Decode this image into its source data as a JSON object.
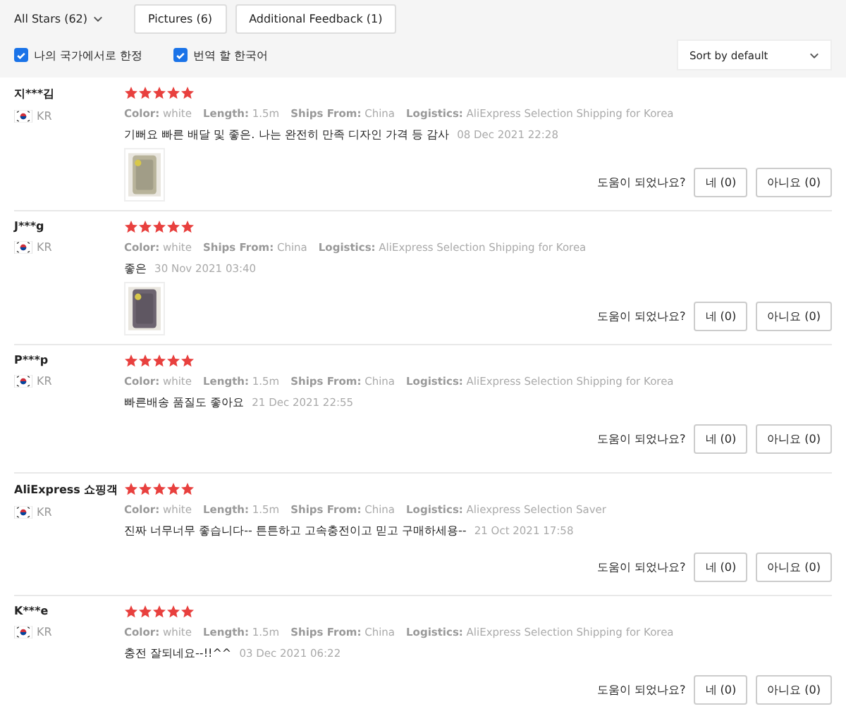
{
  "filters": {
    "star_filter": "All Stars (62)",
    "buttons": [
      "Pictures (6)",
      "Additional Feedback (1)"
    ]
  },
  "options": [
    {
      "label": "나의 국가에서로 한정",
      "checked": true
    },
    {
      "label": "번역 할 한국어",
      "checked": true
    }
  ],
  "sort": {
    "value": "Sort by default"
  },
  "reviews": [
    {
      "name": "지***김",
      "country": "KR",
      "stars": 5,
      "attributes": [
        {
          "label": "Color:",
          "value": "white"
        },
        {
          "label": "Length:",
          "value": "1.5m"
        },
        {
          "label": "Ships From:",
          "value": "China"
        },
        {
          "label": "Logistics:",
          "value": "AliExpress Selection Shipping for Korea"
        }
      ],
      "comment": "기뻐요 빠른 배달 및 좋은. 나는 완전히 만족 디자인 가격 등 감사",
      "date": "08 Dec 2021 22:28",
      "photos": [
        {
          "kind": "picture"
        }
      ],
      "helpful": "도움이 되었나요?",
      "yes": "네 (0)",
      "no": "아니요 (0)"
    },
    {
      "name": "J***g",
      "country": "KR",
      "stars": 5,
      "attributes": [
        {
          "label": "Color:",
          "value": "white"
        },
        {
          "label": "Ships From:",
          "value": "China"
        },
        {
          "label": "Logistics:",
          "value": "AliExpress Selection Shipping for Korea"
        }
      ],
      "comment": "좋은",
      "date": "30 Nov 2021 03:40",
      "photos": [
        {
          "kind": "picture"
        }
      ],
      "helpful": "도움이 되었나요?",
      "yes": "네 (0)",
      "no": "아니요 (0)"
    },
    {
      "name": "P***p",
      "country": "KR",
      "stars": 5,
      "attributes": [
        {
          "label": "Color:",
          "value": "white"
        },
        {
          "label": "Length:",
          "value": "1.5m"
        },
        {
          "label": "Ships From:",
          "value": "China"
        },
        {
          "label": "Logistics:",
          "value": "AliExpress Selection Shipping for Korea"
        }
      ],
      "comment": "빠른배송 품질도 좋아요",
      "date": "21 Dec 2021 22:55",
      "helpful": "도움이 되었나요?",
      "yes": "네 (0)",
      "no": "아니요 (0)"
    },
    {
      "name": "AliExpress 쇼핑객",
      "country": "KR",
      "stars": 5,
      "attributes": [
        {
          "label": "Color:",
          "value": "white"
        },
        {
          "label": "Length:",
          "value": "1.5m"
        },
        {
          "label": "Ships From:",
          "value": "China"
        },
        {
          "label": "Logistics:",
          "value": "Aliexpress Selection Saver"
        }
      ],
      "comment": "진짜 너무너무 좋습니다-- 튼튼하고 고속충전이고 믿고 구매하세용--",
      "date": "21 Oct 2021 17:58",
      "helpful": "도움이 되었나요?",
      "yes": "네 (0)",
      "no": "아니요 (0)"
    },
    {
      "name": "K***e",
      "country": "KR",
      "stars": 5,
      "attributes": [
        {
          "label": "Color:",
          "value": "white"
        },
        {
          "label": "Length:",
          "value": "1.5m"
        },
        {
          "label": "Ships From:",
          "value": "China"
        },
        {
          "label": "Logistics:",
          "value": "AliExpress Selection Shipping for Korea"
        }
      ],
      "comment": "충전 잘되네요--!!^^",
      "date": "03 Dec 2021 06:22",
      "helpful": "도움이 되었나요?",
      "yes": "네 (0)",
      "no": "아니요 (0)"
    }
  ]
}
